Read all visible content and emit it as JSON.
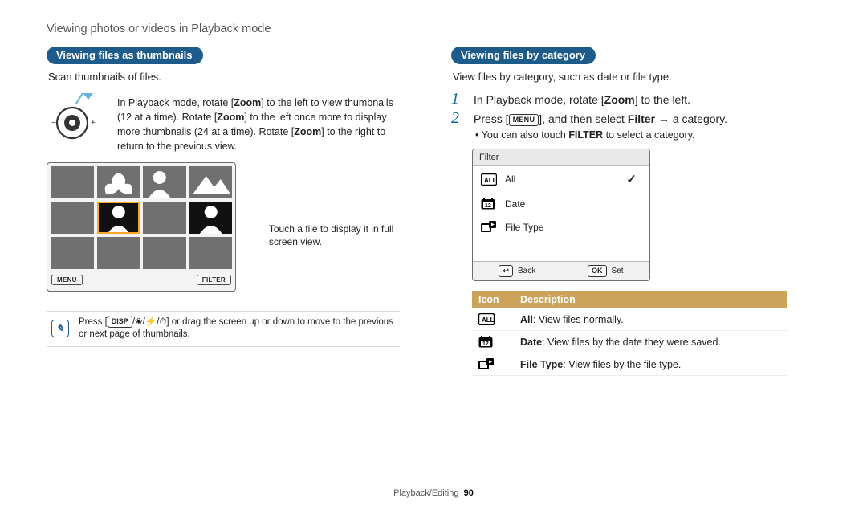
{
  "page": {
    "title": "Viewing photos or videos in Playback mode",
    "footer_section": "Playback/Editing",
    "footer_page": "90"
  },
  "left": {
    "section_title": "Viewing files as thumbnails",
    "subtitle": "Scan thumbnails of files.",
    "zoom_text_pre": "In Playback mode, rotate [",
    "zoom_bold1": "Zoom",
    "zoom_text_mid1": "] to the left to view thumbnails (12 at a time). Rotate [",
    "zoom_bold2": "Zoom",
    "zoom_text_mid2": "] to the left once more to display more thumbnails (24 at a time). Rotate [",
    "zoom_bold3": "Zoom",
    "zoom_text_end": "] to the right to return to the previous view.",
    "thumb_btn_menu": "MENU",
    "thumb_btn_filter": "FILTER",
    "thumb_annotation": "Touch a file to display it in full screen view.",
    "note_pre": "Press [",
    "note_kbd1": "DISP",
    "note_mid1": "/",
    "note_icon_macro": "macro-icon",
    "note_mid2": "/",
    "note_icon_flash": "flash-icon",
    "note_mid3": "/",
    "note_icon_timer": "timer-icon",
    "note_post": "] or drag the screen up or down to move to the previous or next page of thumbnails."
  },
  "right": {
    "section_title": "Viewing files by category",
    "subtitle": "View files by category, such as date or file type.",
    "step1": {
      "num": "1",
      "text_pre": "In Playback mode, rotate [",
      "bold": "Zoom",
      "text_post": "] to the left."
    },
    "step2": {
      "num": "2",
      "text_pre": "Press [",
      "menu_kbd": "MENU",
      "text_mid": "], and then select ",
      "bold": "Filter",
      "arrow": " → ",
      "text_post": "a category."
    },
    "sub_bullet_pre": "You can also touch ",
    "sub_bullet_bold": "FILTER",
    "sub_bullet_post": " to select a category.",
    "filter": {
      "head": "Filter",
      "items": [
        {
          "label": "All",
          "icon": "all-icon",
          "checked": true
        },
        {
          "label": "Date",
          "icon": "calendar-icon",
          "checked": false
        },
        {
          "label": "File Type",
          "icon": "filetype-icon",
          "checked": false
        }
      ],
      "back_label": "Back",
      "set_label": "Set",
      "back_kbd": "↩",
      "set_kbd": "OK"
    },
    "table": {
      "head_icon": "Icon",
      "head_desc": "Description",
      "rows": [
        {
          "icon": "all-icon",
          "bold": "All",
          "text": ": View files normally."
        },
        {
          "icon": "calendar-icon",
          "bold": "Date",
          "text": ": View files by the date they were saved."
        },
        {
          "icon": "filetype-icon",
          "bold": "File Type",
          "text": ": View files by the file type."
        }
      ]
    }
  }
}
